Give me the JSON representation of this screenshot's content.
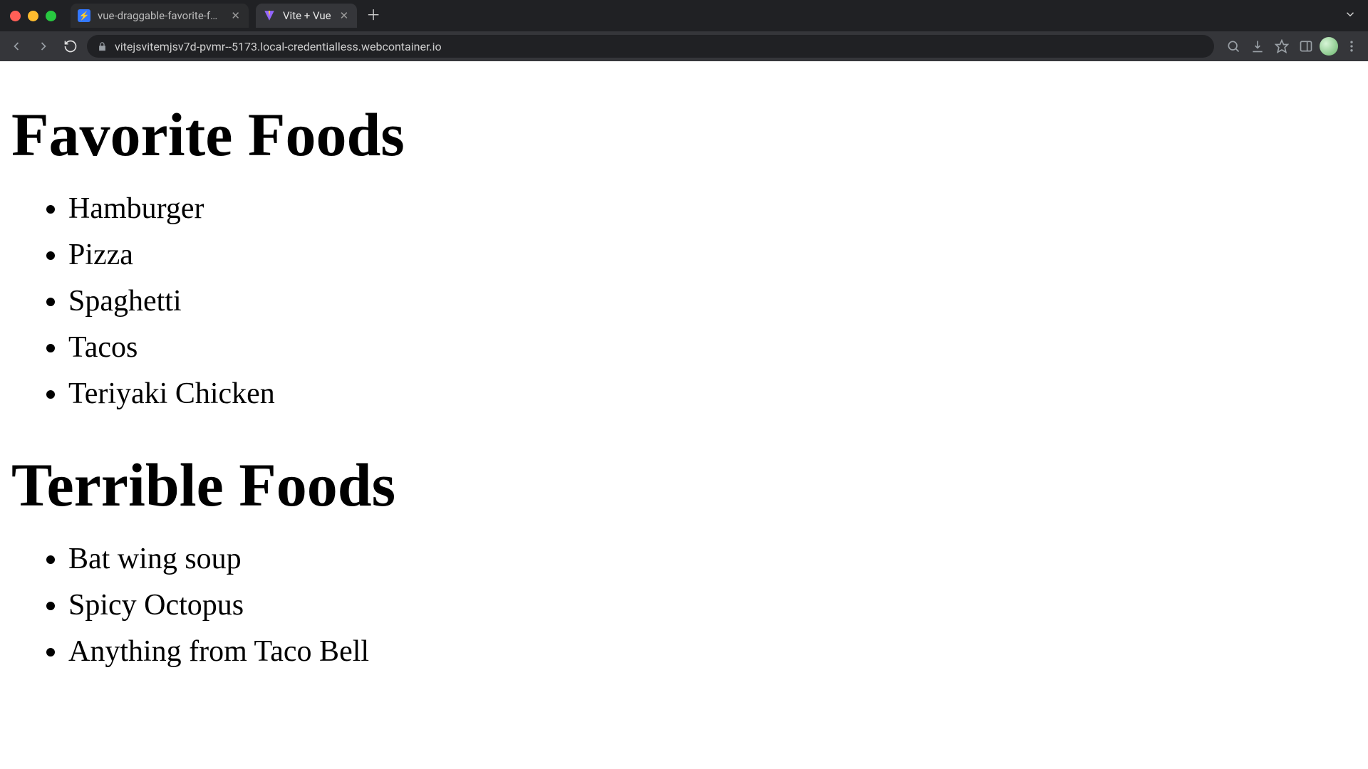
{
  "browser": {
    "tabs": [
      {
        "title": "vue-draggable-favorite-foods",
        "active": false,
        "favicon": "stackblitz"
      },
      {
        "title": "Vite + Vue",
        "active": true,
        "favicon": "vite"
      }
    ],
    "url": "vitejsvitemjsv7d-pvmr--5173.local-credentialless.webcontainer.io"
  },
  "page": {
    "sections": [
      {
        "heading": "Favorite Foods",
        "items": [
          "Hamburger",
          "Pizza",
          "Spaghetti",
          "Tacos",
          "Teriyaki Chicken"
        ]
      },
      {
        "heading": "Terrible Foods",
        "items": [
          "Bat wing soup",
          "Spicy Octopus",
          "Anything from Taco Bell"
        ]
      }
    ]
  }
}
